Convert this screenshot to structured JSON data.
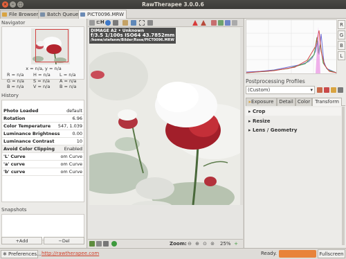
{
  "window": {
    "title": "RawTherapee 3.0.0.6"
  },
  "tabs": [
    {
      "label": "File Browser"
    },
    {
      "label": "Batch Queue"
    },
    {
      "label": "PICT0096.MRW"
    }
  ],
  "navigator": {
    "title": "Navigator",
    "coords": "x = n/a, y = n/a",
    "rgb": [
      "R = n/a",
      "G = n/a",
      "B = n/a"
    ],
    "hsv": [
      "H = n/a",
      "S = n/a",
      "V = n/a"
    ],
    "lab": [
      "L = n/a",
      "A = n/a",
      "B = n/a"
    ]
  },
  "history": {
    "title": "History",
    "rows": [
      {
        "key": "Photo Loaded",
        "value": "default"
      },
      {
        "key": "Rotation",
        "value": "6.96"
      },
      {
        "key": "Color Temperature",
        "value": "547, 1.039"
      },
      {
        "key": "Luminance Brightness",
        "value": "0.00"
      },
      {
        "key": "Luminance Contrast",
        "value": "10"
      },
      {
        "key": "Avoid Color Clipping",
        "value": "Enabled"
      },
      {
        "key": "'L' Curve",
        "value": "om Curve"
      },
      {
        "key": "'a' curve",
        "value": "om Curve"
      },
      {
        "key": "'b' curve",
        "value": "om Curve"
      }
    ]
  },
  "snapshots": {
    "title": "Snapshots",
    "add_label": "Add",
    "del_label": "Del"
  },
  "image": {
    "meta_line1": "DIMAGE A2 • Unknown",
    "meta_line2": "f/3.5  1/100s  ISO64  43.7852mm",
    "meta_path": "/home/stefanm/Bilder/Rose/PICT0096.MRW"
  },
  "zoom": {
    "label": "Zoom:",
    "value": "25%"
  },
  "toolbar_h": "H",
  "postproc": {
    "label": "Postprocessing Profiles",
    "selected": "(Custom)"
  },
  "right_tabs": [
    {
      "label": "Exposure"
    },
    {
      "label": "Detail"
    },
    {
      "label": "Color"
    },
    {
      "label": "Transform"
    }
  ],
  "tools": [
    {
      "label": "Crop"
    },
    {
      "label": "Resize"
    },
    {
      "label": "Lens / Geometry"
    }
  ],
  "rgb_buttons": [
    "R",
    "G",
    "B",
    "L"
  ],
  "statusbar": {
    "pref": "Preferences...",
    "link": "http://rawtherapee.com",
    "ready": "Ready.",
    "fullscreen": "Fullscreen"
  }
}
